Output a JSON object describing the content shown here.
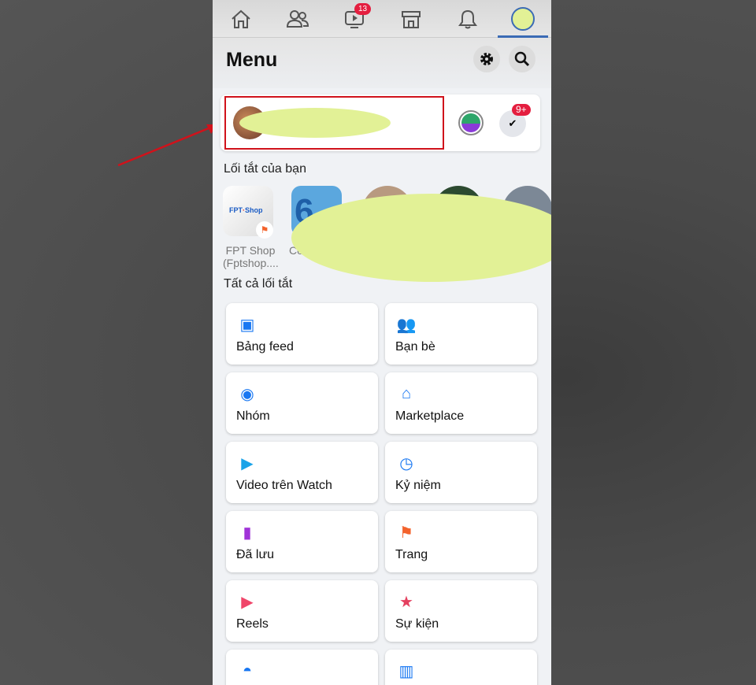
{
  "nav": {
    "items": [
      "home",
      "friends",
      "watch",
      "marketplace",
      "notifications",
      "profile"
    ],
    "watch_badge": "13"
  },
  "header": {
    "title": "Menu"
  },
  "profile": {
    "notification_badge": "9+"
  },
  "shortcuts": {
    "heading": "Lối tắt của bạn",
    "items": [
      {
        "label": "FPT Shop (Fptshop...."
      },
      {
        "label": "Confes"
      }
    ]
  },
  "all_shortcuts": {
    "heading": "Tất cả lối tắt",
    "items": [
      {
        "label": "Bảng feed",
        "icon": "feed-icon",
        "color": "#1877f2"
      },
      {
        "label": "Bạn bè",
        "icon": "friends-icon",
        "color": "#1877f2"
      },
      {
        "label": "Nhóm",
        "icon": "groups-icon",
        "color": "#1877f2"
      },
      {
        "label": "Marketplace",
        "icon": "marketplace-icon",
        "color": "#1877f2"
      },
      {
        "label": "Video trên Watch",
        "icon": "watch-icon",
        "color": "#1aa3e8"
      },
      {
        "label": "Kỷ niệm",
        "icon": "memories-icon",
        "color": "#1877f2"
      },
      {
        "label": "Đã lưu",
        "icon": "saved-icon",
        "color": "#a033d8"
      },
      {
        "label": "Trang",
        "icon": "pages-icon",
        "color": "#f3622b"
      },
      {
        "label": "Reels",
        "icon": "reels-icon",
        "color": "#f0466a"
      },
      {
        "label": "Sự kiện",
        "icon": "events-icon",
        "color": "#e4405f"
      },
      {
        "label": "",
        "icon": "gaming-icon",
        "color": "#1877f2"
      },
      {
        "label": "",
        "icon": "book-icon",
        "color": "#1877f2"
      }
    ]
  },
  "colors": {
    "annotation": "#d0121b",
    "redaction": "#e2f196"
  }
}
